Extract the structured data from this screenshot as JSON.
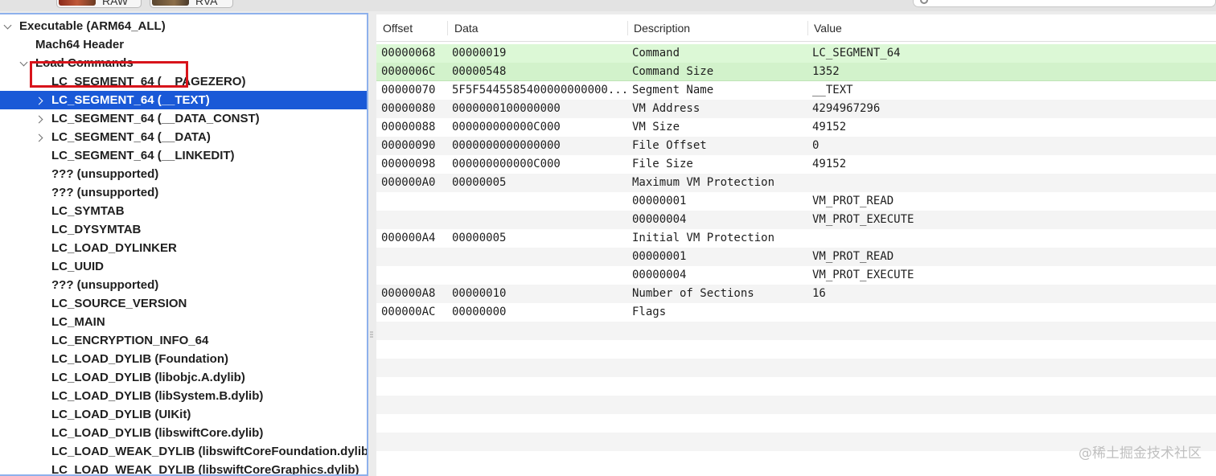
{
  "toolbar": {
    "raw_label": "RAW",
    "rva_label": "RVA",
    "search_icon": "search-icon"
  },
  "tree": {
    "items": [
      {
        "label": "Executable  (ARM64_ALL)",
        "level": 0,
        "disclosure": "expanded",
        "selected": false
      },
      {
        "label": "Mach64 Header",
        "level": 1,
        "disclosure": "none",
        "selected": false
      },
      {
        "label": "Load Commands",
        "level": 1,
        "disclosure": "expanded",
        "selected": false,
        "highlighted": true
      },
      {
        "label": "LC_SEGMENT_64 (__PAGEZERO)",
        "level": 2,
        "disclosure": "none",
        "selected": false
      },
      {
        "label": "LC_SEGMENT_64 (__TEXT)",
        "level": 2,
        "disclosure": "collapsed",
        "selected": true
      },
      {
        "label": "LC_SEGMENT_64 (__DATA_CONST)",
        "level": 2,
        "disclosure": "collapsed",
        "selected": false
      },
      {
        "label": "LC_SEGMENT_64 (__DATA)",
        "level": 2,
        "disclosure": "collapsed",
        "selected": false
      },
      {
        "label": "LC_SEGMENT_64 (__LINKEDIT)",
        "level": 2,
        "disclosure": "none",
        "selected": false
      },
      {
        "label": "??? (unsupported)",
        "level": 2,
        "disclosure": "none",
        "selected": false
      },
      {
        "label": "??? (unsupported)",
        "level": 2,
        "disclosure": "none",
        "selected": false
      },
      {
        "label": "LC_SYMTAB",
        "level": 2,
        "disclosure": "none",
        "selected": false
      },
      {
        "label": "LC_DYSYMTAB",
        "level": 2,
        "disclosure": "none",
        "selected": false
      },
      {
        "label": "LC_LOAD_DYLINKER",
        "level": 2,
        "disclosure": "none",
        "selected": false
      },
      {
        "label": "LC_UUID",
        "level": 2,
        "disclosure": "none",
        "selected": false
      },
      {
        "label": "??? (unsupported)",
        "level": 2,
        "disclosure": "none",
        "selected": false
      },
      {
        "label": "LC_SOURCE_VERSION",
        "level": 2,
        "disclosure": "none",
        "selected": false
      },
      {
        "label": "LC_MAIN",
        "level": 2,
        "disclosure": "none",
        "selected": false
      },
      {
        "label": "LC_ENCRYPTION_INFO_64",
        "level": 2,
        "disclosure": "none",
        "selected": false
      },
      {
        "label": "LC_LOAD_DYLIB (Foundation)",
        "level": 2,
        "disclosure": "none",
        "selected": false
      },
      {
        "label": "LC_LOAD_DYLIB (libobjc.A.dylib)",
        "level": 2,
        "disclosure": "none",
        "selected": false
      },
      {
        "label": "LC_LOAD_DYLIB (libSystem.B.dylib)",
        "level": 2,
        "disclosure": "none",
        "selected": false
      },
      {
        "label": "LC_LOAD_DYLIB (UIKit)",
        "level": 2,
        "disclosure": "none",
        "selected": false
      },
      {
        "label": "LC_LOAD_DYLIB (libswiftCore.dylib)",
        "level": 2,
        "disclosure": "none",
        "selected": false
      },
      {
        "label": "LC_LOAD_WEAK_DYLIB (libswiftCoreFoundation.dylib)",
        "level": 2,
        "disclosure": "none",
        "selected": false
      },
      {
        "label": "LC_LOAD_WEAK_DYLIB (libswiftCoreGraphics.dylib)",
        "level": 2,
        "disclosure": "none",
        "selected": false
      }
    ]
  },
  "table": {
    "headers": {
      "offset": "Offset",
      "data": "Data",
      "description": "Description",
      "value": "Value"
    },
    "rows": [
      {
        "offset": "00000068",
        "data": "00000019",
        "description": "Command",
        "value": "LC_SEGMENT_64",
        "green": true
      },
      {
        "offset": "0000006C",
        "data": "00000548",
        "description": "Command Size",
        "value": "1352",
        "green": true
      },
      {
        "offset": "00000070",
        "data": "5F5F5445585400000000000...",
        "description": "Segment Name",
        "value": "__TEXT"
      },
      {
        "offset": "00000080",
        "data": "0000000100000000",
        "description": "VM Address",
        "value": "4294967296"
      },
      {
        "offset": "00000088",
        "data": "000000000000C000",
        "description": "VM Size",
        "value": "49152"
      },
      {
        "offset": "00000090",
        "data": "0000000000000000",
        "description": "File Offset",
        "value": "0"
      },
      {
        "offset": "00000098",
        "data": "000000000000C000",
        "description": "File Size",
        "value": "49152"
      },
      {
        "offset": "000000A0",
        "data": "00000005",
        "description": "Maximum VM Protection",
        "value": ""
      },
      {
        "offset": "",
        "data": "",
        "description": "00000001",
        "value": "VM_PROT_READ"
      },
      {
        "offset": "",
        "data": "",
        "description": "00000004",
        "value": "VM_PROT_EXECUTE"
      },
      {
        "offset": "000000A4",
        "data": "00000005",
        "description": "Initial VM Protection",
        "value": ""
      },
      {
        "offset": "",
        "data": "",
        "description": "00000001",
        "value": "VM_PROT_READ"
      },
      {
        "offset": "",
        "data": "",
        "description": "00000004",
        "value": "VM_PROT_EXECUTE"
      },
      {
        "offset": "000000A8",
        "data": "00000010",
        "description": "Number of Sections",
        "value": "16"
      },
      {
        "offset": "000000AC",
        "data": "00000000",
        "description": "Flags",
        "value": ""
      }
    ],
    "empty_rows": 8
  },
  "watermark": "@稀土掘金技术社区",
  "colors": {
    "selection": "#1a59d7",
    "highlight_box": "#d8141b",
    "green_row": "#dcf8d6",
    "focus_border": "#8eb1ec"
  }
}
